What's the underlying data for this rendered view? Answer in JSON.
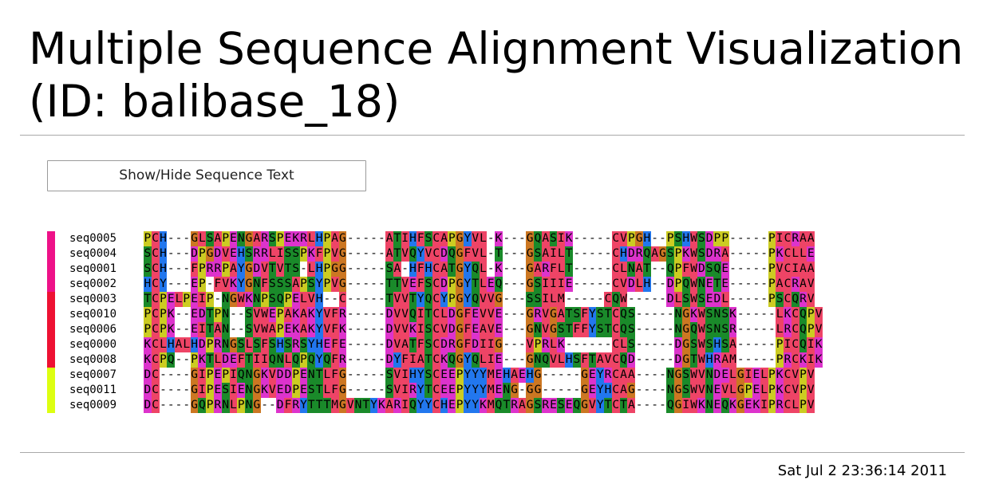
{
  "page": {
    "title_line1": "Multiple Sequence Alignment Visualization",
    "title_line2": "(ID: balibase_18)",
    "toggle_button_label": "Show/Hide Sequence Text",
    "timestamp": "Sat Jul 2 23:36:14 2011"
  },
  "alignment": {
    "groups": [
      {
        "color": "#ee1188",
        "rows": 4
      },
      {
        "color": "#ee1133",
        "rows": 5
      },
      {
        "color": "#ddff11",
        "rows": 3
      }
    ],
    "rows": [
      {
        "name": "seq0005",
        "sequence": "PCH---GLSAPENGARSPEKRLHPAG-----ATIHFSCAPGYVL-K---GQASIK-----CVPGH--PSHWSDPP-----PICRAA"
      },
      {
        "name": "seq0004",
        "sequence": "SCH---DPGDVEHSRRLISSPKFPVG-----ATVQYVCDQGFVL-T---GSAILT-----CHDRQAGSPKWSDRA-----PKCLLE"
      },
      {
        "name": "seq0001",
        "sequence": "SCH---FPRRPAYGDVTVTS-LHPGG-----SA-HFHCATGYQL-K---GARFLT-----CLNAT--QPFWDSQE-----PVCIAA"
      },
      {
        "name": "seq0002",
        "sequence": "HCY---EP-FVKYGNFSSSAPSYPVG-----TTVEFSCDPGYTLEQ---GSIIIE-----CVDLH--DPQWNETE-----PACRAV"
      },
      {
        "name": "seq0003",
        "sequence": "TCPELPEIP-NGWKNPSQPELVH--C-----TVVTYQCYPGYQVVG---SSILM-----CQW-----DLSWSEDL-----PSCQRV"
      },
      {
        "name": "seq0010",
        "sequence": "PCPK--EDTPN--SVWEPAKAKYVFR-----DVVQITCLDGFEVVE---GRVGATSFYSTCQS-----NGKWSNSK-----LKCQPV"
      },
      {
        "name": "seq0006",
        "sequence": "PCPK--EITAN--SVWAPEKAKYVFK-----DVVKISCVDGFEAVE---GNVGSTFFYSTCQS-----NGQWSNSR-----LRCQPV"
      },
      {
        "name": "seq0000",
        "sequence": "KCLHALHDPRNGSLSFSHSRSYHEFE-----DVATFSCDRGFDIIG---VPRLK------CLS-----DGSWSHSA-----PICQIK"
      },
      {
        "name": "seq0008",
        "sequence": "KCPQ--PKTLDEFTIIQNLQPQYQFR-----DYFIATCKQGYQLIE---GNQVLHSFTAVCQD-----DGTWHRAM-----PRCKIK"
      },
      {
        "name": "seq0007",
        "sequence": "DC----GIPEPIQNGKVDDPENTLFG-----SVIHYSCEEPYYYMEHAEHG-----GEYRCAA----NGSWVNDELGIELPKCVPV"
      },
      {
        "name": "seq0011",
        "sequence": "DC----GIPESIENGKVEDPESTLFG-----SVIRYTCEEPYYYMENG-GG-----GEYHCAG----NGSWVNEVLGPELPKCVPV"
      },
      {
        "name": "seq0009",
        "sequence": "DC----GQPRNLPNG--DFRYTTTMGVNTYKARIQYYCHEPYYKMQTRAGSRESEQGVYTCTA----QGIWKNEQKGEKIPRCLPV"
      }
    ],
    "residue_colors": {
      "A": "#ee4466",
      "I": "#ee4466",
      "L": "#ee4466",
      "M": "#ee4466",
      "F": "#ee4466",
      "W": "#ee4466",
      "V": "#ee4466",
      "C": "#ee4466",
      "K": "#dd33cc",
      "R": "#dd33cc",
      "E": "#dd33cc",
      "D": "#dd33cc",
      "N": "#1a8a2a",
      "Q": "#1a8a2a",
      "S": "#1a8a2a",
      "T": "#1a8a2a",
      "G": "#cc7722",
      "P": "#cccc22",
      "H": "#2277ee",
      "Y": "#2277ee",
      "-": "#ffffff"
    }
  }
}
